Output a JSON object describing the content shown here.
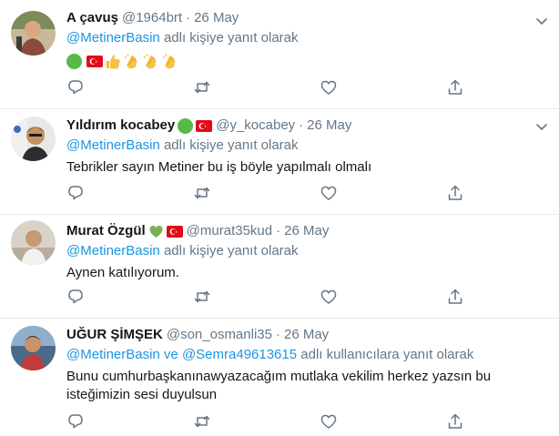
{
  "tweets": [
    {
      "name": "A çavuş",
      "handle": "@1964brt",
      "sep": "·",
      "date": "26 May",
      "reply_mention": "@MetinerBasin",
      "reply_suffix": " adlı kişiye yanıt olarak",
      "emojis": [
        "green-circle",
        "turkey-flag",
        "thumbs-up",
        "clapping-hands",
        "clapping-hands",
        "clapping-hands"
      ]
    },
    {
      "name": "Yıldırım kocabey",
      "handle": "@y_kocabey",
      "sep": "·",
      "date": "26 May",
      "reply_mention": "@MetinerBasin",
      "reply_suffix": " adlı kişiye yanıt olarak",
      "text": "Tebrikler sayın Metiner bu iş böyle yapılmalı olmalı",
      "name_emojis": [
        "green-circle",
        "turkey-flag"
      ]
    },
    {
      "name": "Murat Özgül",
      "handle": "@murat35kud",
      "sep": "·",
      "date": "26 May",
      "reply_mention": "@MetinerBasin",
      "reply_suffix": " adlı kişiye yanıt olarak",
      "text": "Aynen katılıyorum.",
      "name_emojis": [
        "green-heart",
        "turkey-flag"
      ]
    },
    {
      "name": "UĞUR ŞİMŞEK",
      "handle": "@son_osmanli35",
      "sep": "·",
      "date": "26 May",
      "reply_mention": "@MetinerBasin ve @Semra49613615",
      "reply_suffix": " adlı kullanıcılara yanıt olarak",
      "text": "Bunu cumhurbaşkanınawyazacağım mutlaka vekilim herkez yazsın bu isteğimizin sesi duyulsun"
    }
  ],
  "colors": {
    "link": "#1b95e0",
    "secondary": "#657786",
    "divider": "#e6ecf0",
    "icon": "#657786"
  }
}
